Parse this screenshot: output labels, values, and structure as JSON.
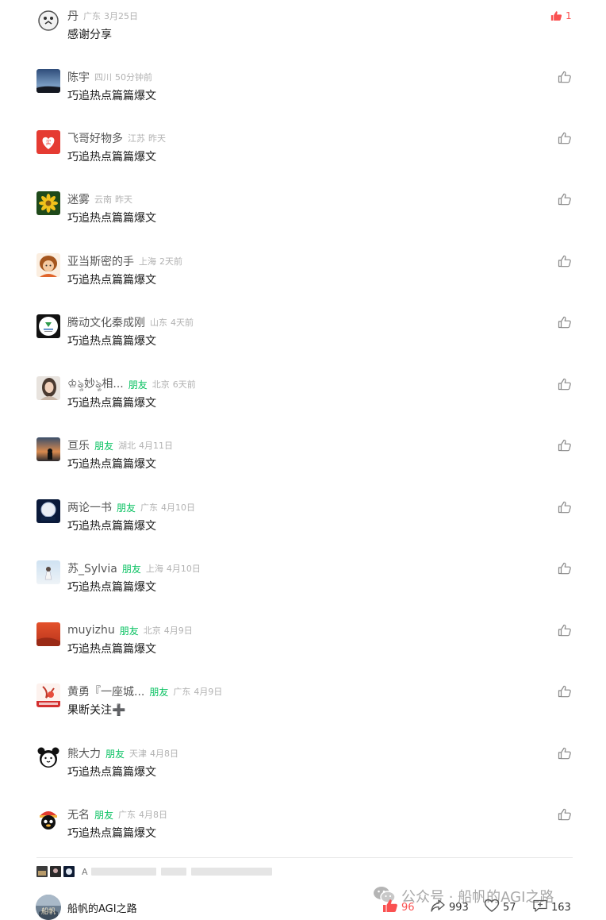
{
  "comments": [
    {
      "name": "丹",
      "friend": "",
      "location": "广东",
      "time": "3月25日",
      "text": "感谢分享",
      "likes": "1",
      "liked": true
    },
    {
      "name": "陈宇",
      "friend": "",
      "location": "四川",
      "time": "50分钟前",
      "text": "巧追热点篇篇爆文",
      "likes": "",
      "liked": false
    },
    {
      "name": "飞哥好物多",
      "friend": "",
      "location": "江苏",
      "time": "昨天",
      "text": "巧追热点篇篇爆文",
      "likes": "",
      "liked": false
    },
    {
      "name": "迷雾",
      "friend": "",
      "location": "云南",
      "time": "昨天",
      "text": "巧追热点篇篇爆文",
      "likes": "",
      "liked": false
    },
    {
      "name": "亚当斯密的手",
      "friend": "",
      "location": "上海",
      "time": "2天前",
      "text": "巧追热点篇篇爆文",
      "likes": "",
      "liked": false
    },
    {
      "name": "腾动文化秦成刚",
      "friend": "",
      "location": "山东",
      "time": "4天前",
      "text": "巧追热点篇篇爆文",
      "likes": "",
      "liked": false
    },
    {
      "name": "♔ৡ妙ৡ相...",
      "friend": "朋友",
      "location": "北京",
      "time": "6天前",
      "text": "巧追热点篇篇爆文",
      "likes": "",
      "liked": false
    },
    {
      "name": "亘乐",
      "friend": "朋友",
      "location": "湖北",
      "time": "4月11日",
      "text": "巧追热点篇篇爆文",
      "likes": "",
      "liked": false
    },
    {
      "name": "两论一书",
      "friend": "朋友",
      "location": "广东",
      "time": "4月10日",
      "text": "巧追热点篇篇爆文",
      "likes": "",
      "liked": false
    },
    {
      "name": "苏_Sylvia",
      "friend": "朋友",
      "location": "上海",
      "time": "4月10日",
      "text": "巧追热点篇篇爆文",
      "likes": "",
      "liked": false
    },
    {
      "name": "muyizhu",
      "friend": "朋友",
      "location": "北京",
      "time": "4月9日",
      "text": "巧追热点篇篇爆文",
      "likes": "",
      "liked": false
    },
    {
      "name": "黄勇『一座城...",
      "friend": "朋友",
      "location": "广东",
      "time": "4月9日",
      "text": "果断关注➕",
      "likes": "",
      "liked": false
    },
    {
      "name": "熊大力",
      "friend": "朋友",
      "location": "天津",
      "time": "4月8日",
      "text": "巧追热点篇篇爆文",
      "likes": "",
      "liked": false
    },
    {
      "name": "无名",
      "friend": "朋友",
      "location": "广东",
      "time": "4月8日",
      "text": "巧追热点篇篇爆文",
      "likes": "",
      "liked": false
    }
  ],
  "preview": {
    "text": "A"
  },
  "watermark": {
    "text": "公众号 · 船帆的AGI之路"
  },
  "footer": {
    "account_name": "船帆的AGI之路",
    "likes": "96",
    "shares": "993",
    "favorites": "57",
    "comments": "163"
  },
  "colors": {
    "like_red": "#fa5151",
    "friend_green": "#07c160",
    "meta_gray": "#b2b2b2"
  },
  "icons": {
    "like": "thumbs-up-outline-icon",
    "liked": "thumbs-up-filled-icon",
    "share": "share-arrow-icon",
    "favorite": "heart-icon",
    "comment": "comment-bubble-icon",
    "wechat": "wechat-logo-icon"
  }
}
